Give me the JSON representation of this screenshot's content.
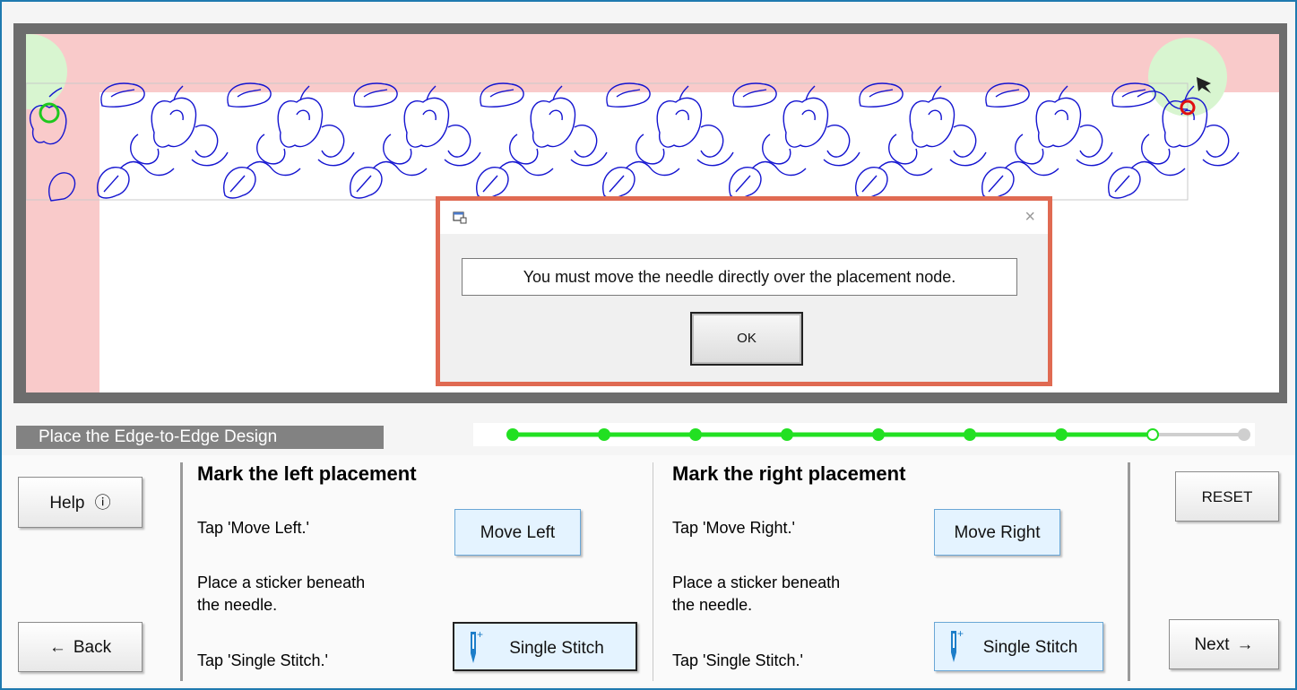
{
  "dialog": {
    "message": "You must move the needle directly over the placement node.",
    "ok_label": "OK",
    "close_glyph": "×",
    "app_icon": "window-icon"
  },
  "step": {
    "title": "Place the Edge-to-Edge Design",
    "progress": {
      "total_steps": 9,
      "completed_steps": 7,
      "current_step": 8
    }
  },
  "left": {
    "heading": "Mark the left placement",
    "instr1": "Tap 'Move Left.'",
    "instr2a": "Place a sticker beneath",
    "instr2b": "the needle.",
    "instr3": "Tap 'Single Stitch.'",
    "move_label": "Move Left",
    "stitch_label": "Single Stitch"
  },
  "right": {
    "heading": "Mark the right placement",
    "instr1": "Tap 'Move Right.'",
    "instr2a": "Place a sticker beneath",
    "instr2b": "the needle.",
    "instr3": "Tap 'Single Stitch.'",
    "move_label": "Move Right",
    "stitch_label": "Single Stitch"
  },
  "nav": {
    "help_label": "Help",
    "help_icon": "ⓘ",
    "back_label": "Back",
    "back_icon": "←",
    "reset_label": "RESET",
    "next_label": "Next",
    "next_icon": "→"
  },
  "colors": {
    "accent_border": "#e06a52",
    "progress_done": "#22e022",
    "progress_todo": "#cfcfcf",
    "design_stroke": "#1414d0",
    "start_node": "#1ec81e",
    "end_node": "#e01010",
    "blue_button": "#e4f3ff"
  }
}
